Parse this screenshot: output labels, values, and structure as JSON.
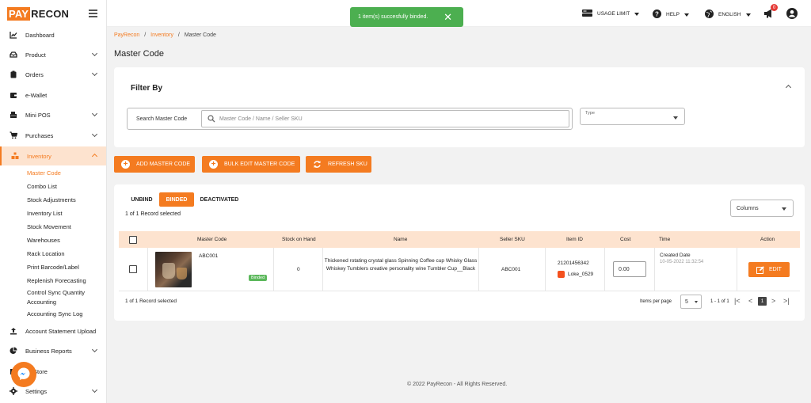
{
  "brand": {
    "box": "PAY",
    "rest": "RECON"
  },
  "sidebar": {
    "items": [
      {
        "label": "Dashboard"
      },
      {
        "label": "Product"
      },
      {
        "label": "Orders"
      },
      {
        "label": "e-Wallet"
      },
      {
        "label": "Mini POS"
      },
      {
        "label": "Purchases"
      },
      {
        "label": "Inventory"
      },
      {
        "label": "Account Statement Upload"
      },
      {
        "label": "Business Reports"
      },
      {
        "label": "Store"
      },
      {
        "label": "Settings"
      }
    ],
    "sub_items": [
      {
        "label": "Master Code"
      },
      {
        "label": "Combo List"
      },
      {
        "label": "Stock Adjustments"
      },
      {
        "label": "Inventory List"
      },
      {
        "label": "Stock Movement"
      },
      {
        "label": "Warehouses"
      },
      {
        "label": "Rack Location"
      },
      {
        "label": "Print Barcode/Label"
      },
      {
        "label": "Replenish Forecasting"
      },
      {
        "label": "Control Sync Quantity"
      },
      {
        "label": "Accounting"
      },
      {
        "label": "Accounting Sync Log"
      }
    ]
  },
  "toast": {
    "message": "1 item(s) succesfully binded.",
    "close": "✕"
  },
  "topbar": {
    "usage_limit": "USAGE LIMIT",
    "help": "HELP",
    "language": "ENGLISH",
    "notification_count": "0"
  },
  "breadcrumb": {
    "root": "PayRecon",
    "parent": "Inventory",
    "current": "Master Code"
  },
  "page_title": "Master Code",
  "filter": {
    "title": "Filter By",
    "search_label": "Search Master Code",
    "search_placeholder": "Master Code / Name / Seller SKU",
    "type_label": "Type"
  },
  "actions": {
    "add": "ADD MASTER CODE",
    "bulk_edit": "BULK EDIT MASTER CODE",
    "refresh": "REFRESH SKU"
  },
  "tabs": [
    {
      "label": "UNBIND"
    },
    {
      "label": "BINDED"
    },
    {
      "label": "DEACTIVATED"
    }
  ],
  "record_info": "1 of 1 Record selected",
  "columns_label": "Columns",
  "table": {
    "headers": [
      "Master Code",
      "Stock on Hand",
      "Name",
      "Seller SKU",
      "Item ID",
      "Cost",
      "Time",
      "Action"
    ],
    "rows": [
      {
        "master_code": "ABC001",
        "badge": "Binded",
        "stock": "0",
        "name": "Thickened rotating crystal glass Spinning Coffee cup Whisky Glass Whiskey Tumblers creative personality wine Tumbler Cup__Black",
        "seller_sku": "ABC001",
        "item_id": "21201456342",
        "store": "Loke_0529",
        "cost": "0.00",
        "time_label": "Created Date",
        "time_value": "10-05-2022 11:32:54",
        "action": "EDIT"
      }
    ]
  },
  "pagination": {
    "items_per_page_label": "Items per page",
    "items_per_page": "5",
    "range": "1 - 1 of 1",
    "current_page": "1"
  },
  "footer": "© 2022 PayRecon - All Rights Reserved.",
  "colors": {
    "accent": "#f47b20",
    "success": "#4caf50",
    "badge": "#5cb85c"
  }
}
